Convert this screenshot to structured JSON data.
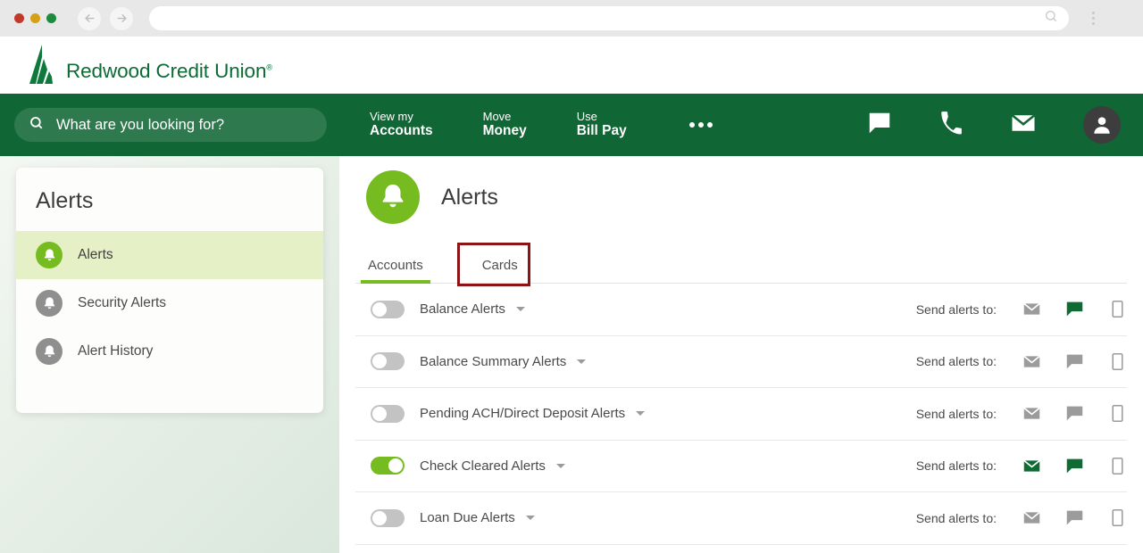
{
  "browser": {
    "url_value": "",
    "url_placeholder": "",
    "back_icon": "back-arrow-icon",
    "forward_icon": "forward-arrow-icon",
    "search_icon": "search-icon",
    "menu_icon": "kebab-menu-icon"
  },
  "brand": {
    "name": "Redwood Credit Union",
    "trademark": "®",
    "logo_icon": "redwood-tree-logo",
    "color": "#0d6b35"
  },
  "topnav": {
    "search_placeholder": "What are you looking for?",
    "search_icon": "search-icon",
    "items": [
      {
        "top": "View my",
        "bottom": "Accounts"
      },
      {
        "top": "Move",
        "bottom": "Money"
      },
      {
        "top": "Use",
        "bottom": "Bill Pay"
      }
    ],
    "more_icon": "more-horizontal-icon",
    "icons": [
      {
        "name": "chat-icon"
      },
      {
        "name": "phone-icon"
      },
      {
        "name": "mail-icon"
      }
    ],
    "avatar_icon": "user-avatar-icon",
    "background_color": "#116635"
  },
  "sidebar": {
    "title": "Alerts",
    "items": [
      {
        "label": "Alerts",
        "icon": "bell-icon",
        "active": true
      },
      {
        "label": "Security Alerts",
        "icon": "bell-icon",
        "active": false
      },
      {
        "label": "Alert History",
        "icon": "bell-icon",
        "active": false
      }
    ],
    "active_color": "#e5f0c6",
    "active_icon_color": "#76bc21"
  },
  "main": {
    "page_title": "Alerts",
    "page_icon": "bell-icon",
    "tabs": [
      {
        "label": "Accounts",
        "active": true
      },
      {
        "label": "Cards",
        "active": false,
        "highlighted": true
      }
    ],
    "annotation_color": "#8c1414",
    "send_label": "Send alerts to:",
    "rows": [
      {
        "label": "Balance Alerts",
        "toggle": "off",
        "caret_icon": "chevron-down-icon",
        "channels": [
          {
            "name": "email-channel-icon",
            "state": "off"
          },
          {
            "name": "message-channel-icon",
            "state": "on"
          },
          {
            "name": "mobile-channel-icon",
            "state": "off"
          }
        ]
      },
      {
        "label": "Balance Summary Alerts",
        "toggle": "off",
        "caret_icon": "chevron-down-icon",
        "channels": [
          {
            "name": "email-channel-icon",
            "state": "off"
          },
          {
            "name": "message-channel-icon",
            "state": "off"
          },
          {
            "name": "mobile-channel-icon",
            "state": "off"
          }
        ]
      },
      {
        "label": "Pending ACH/Direct Deposit Alerts",
        "toggle": "off",
        "caret_icon": "chevron-down-icon",
        "channels": [
          {
            "name": "email-channel-icon",
            "state": "off"
          },
          {
            "name": "message-channel-icon",
            "state": "off"
          },
          {
            "name": "mobile-channel-icon",
            "state": "off"
          }
        ]
      },
      {
        "label": "Check Cleared Alerts",
        "toggle": "on",
        "caret_icon": "chevron-down-icon",
        "channels": [
          {
            "name": "email-channel-icon",
            "state": "on"
          },
          {
            "name": "message-channel-icon",
            "state": "on"
          },
          {
            "name": "mobile-channel-icon",
            "state": "off"
          }
        ]
      },
      {
        "label": "Loan Due Alerts",
        "toggle": "off",
        "caret_icon": "chevron-down-icon",
        "channels": [
          {
            "name": "email-channel-icon",
            "state": "off"
          },
          {
            "name": "message-channel-icon",
            "state": "off"
          },
          {
            "name": "mobile-channel-icon",
            "state": "off"
          }
        ]
      }
    ]
  }
}
